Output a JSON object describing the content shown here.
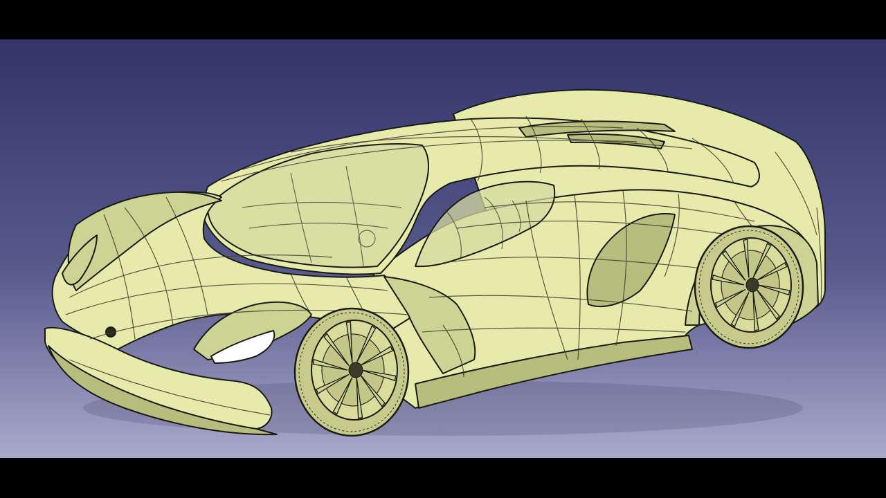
{
  "viewport": {
    "background_top": "#33346a",
    "background_bottom": "#a9a9cc",
    "letterbox": "#000000"
  },
  "model": {
    "surface_fill": "#e6ebab",
    "surface_shade": "#cdd392",
    "surface_dark": "#b7bd7c",
    "glass_fill": "#d4d9a0",
    "edge_color": "#1a1a14",
    "isoparm_color": "#3c3c2c",
    "wheel_spoke_count": 10,
    "headlight_fill": "#ffffff"
  }
}
